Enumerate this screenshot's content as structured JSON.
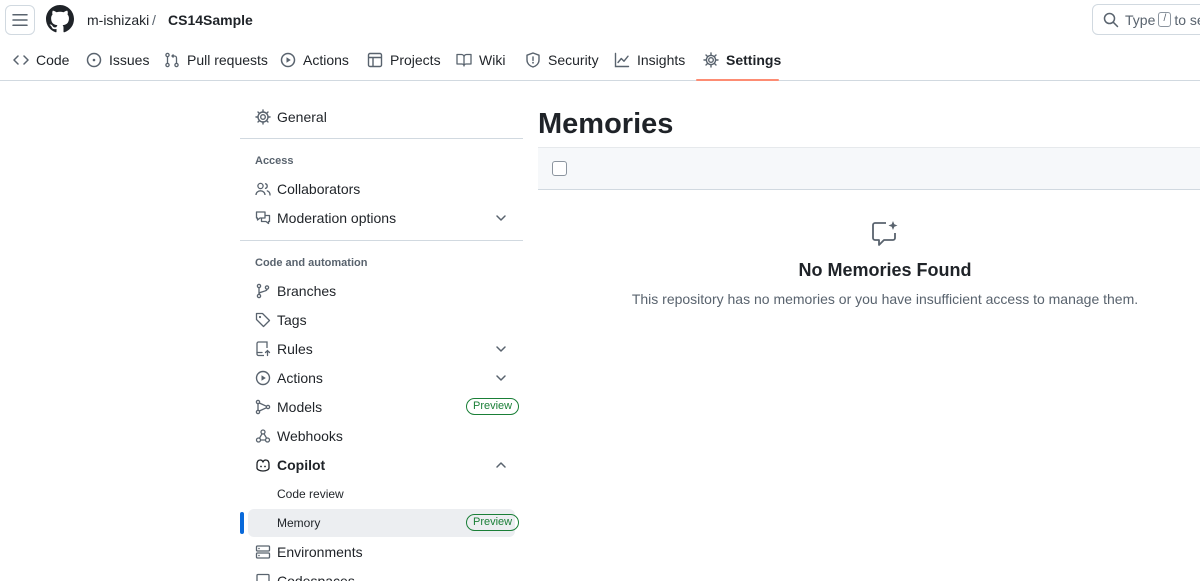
{
  "header": {
    "owner": "m-ishizaki",
    "separator": "/",
    "repo": "CS14Sample",
    "search_placeholder_prefix": "Type",
    "search_key": "/",
    "search_placeholder_suffix": "to se"
  },
  "repo_nav": {
    "tabs": [
      {
        "label": "Code",
        "icon": "code-icon"
      },
      {
        "label": "Issues",
        "icon": "issue-opened-icon"
      },
      {
        "label": "Pull requests",
        "icon": "git-pull-request-icon"
      },
      {
        "label": "Actions",
        "icon": "play-icon"
      },
      {
        "label": "Projects",
        "icon": "table-icon"
      },
      {
        "label": "Wiki",
        "icon": "book-icon"
      },
      {
        "label": "Security",
        "icon": "shield-icon"
      },
      {
        "label": "Insights",
        "icon": "graph-icon"
      },
      {
        "label": "Settings",
        "icon": "gear-icon",
        "active": true
      }
    ]
  },
  "sidebar": {
    "general": "General",
    "group_access": "Access",
    "collaborators": "Collaborators",
    "moderation": "Moderation options",
    "group_code": "Code and automation",
    "branches": "Branches",
    "tags": "Tags",
    "rules": "Rules",
    "actions": "Actions",
    "models": "Models",
    "models_badge": "Preview",
    "webhooks": "Webhooks",
    "copilot": "Copilot",
    "code_review": "Code review",
    "memory": "Memory",
    "memory_badge": "Preview",
    "environments": "Environments",
    "codespaces": "Codespaces"
  },
  "main": {
    "title": "Memories",
    "empty_title": "No Memories Found",
    "empty_description": "This repository has no memories or you have insufficient access to manage them."
  },
  "colors": {
    "accent_selected": "#0969da",
    "tab_underline": "#fd8c73",
    "preview_badge": "#1a7f37"
  }
}
